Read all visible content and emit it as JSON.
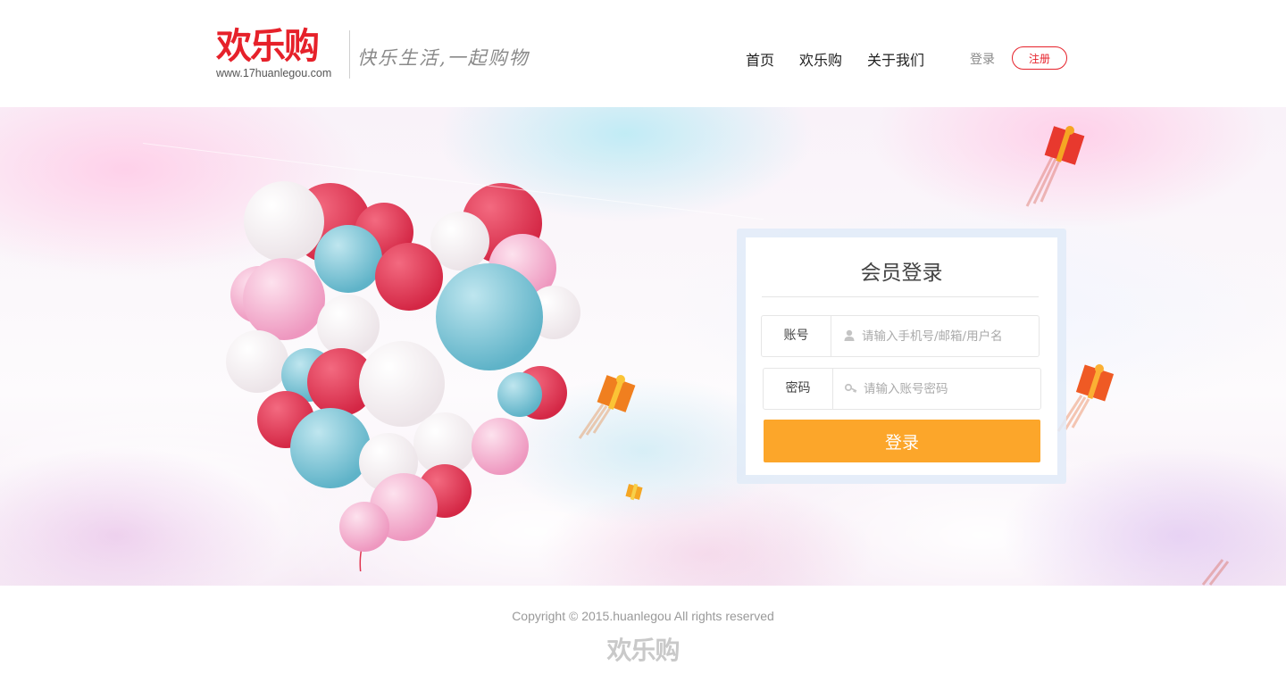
{
  "header": {
    "logo_text": "欢乐购",
    "logo_url": "www.17huanlegou.com",
    "slogan": "快乐生活,一起购物",
    "nav": [
      {
        "label": "首页"
      },
      {
        "label": "欢乐购"
      },
      {
        "label": "关于我们"
      }
    ],
    "login_label": "登录",
    "register_label": "注册"
  },
  "login_form": {
    "title": "会员登录",
    "account_label": "账号",
    "account_placeholder": "请输入手机号/邮箱/用户名",
    "account_value": "",
    "account_icon": "user-icon",
    "password_label": "密码",
    "password_placeholder": "请输入账号密码",
    "password_value": "",
    "password_icon": "key-icon",
    "submit_label": "登录"
  },
  "footer": {
    "copyright": "Copyright © 2015.huanlegou All rights reserved",
    "logo_text": "欢乐购"
  },
  "colors": {
    "brand_red": "#e6212a",
    "button_orange": "#fca62a",
    "balloon_pink": "#f3a7c8",
    "balloon_red": "#e0344f",
    "balloon_blue": "#7ec8d9"
  }
}
